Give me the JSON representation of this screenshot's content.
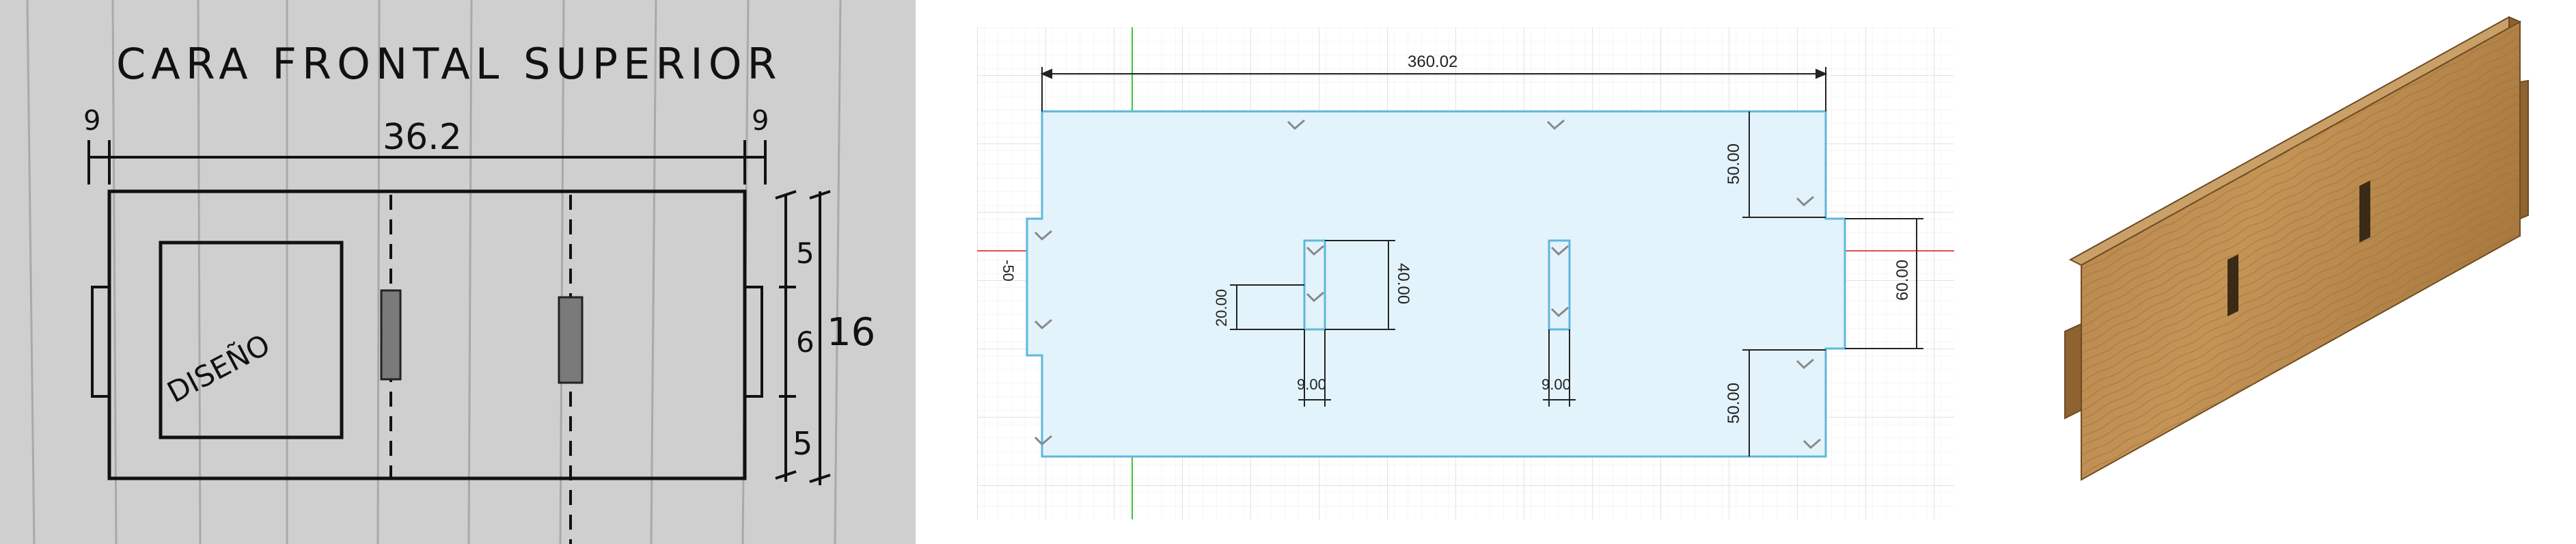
{
  "sketch": {
    "title": "CARA FRONTAL SUPERIOR",
    "top_dim": "36.2",
    "left_tab": "9",
    "right_tab": "9",
    "design_label": "DISEÑO",
    "right_dims": {
      "top": "5",
      "middle": "6",
      "bottom": "5",
      "total": "16"
    }
  },
  "cad": {
    "overall_width": "360.02",
    "top_notch": "50.00",
    "bottom_notch": "50.00",
    "tab_height": "60.00",
    "slot_height": "40.00",
    "slot_offset": "20.00",
    "slot1_width": "9.00",
    "slot2_width": "9.00",
    "axis_label_top": "50",
    "axis_label_left": "-50"
  },
  "colors": {
    "sketch_paper": "#cfcfcf",
    "cad_fill": "#e3f3fb",
    "cad_outline": "#5fb7dd",
    "axis_red": "#e05050",
    "axis_green": "#3cc43c",
    "wood_face": "#b8864a",
    "wood_edge": "#8e6330"
  }
}
